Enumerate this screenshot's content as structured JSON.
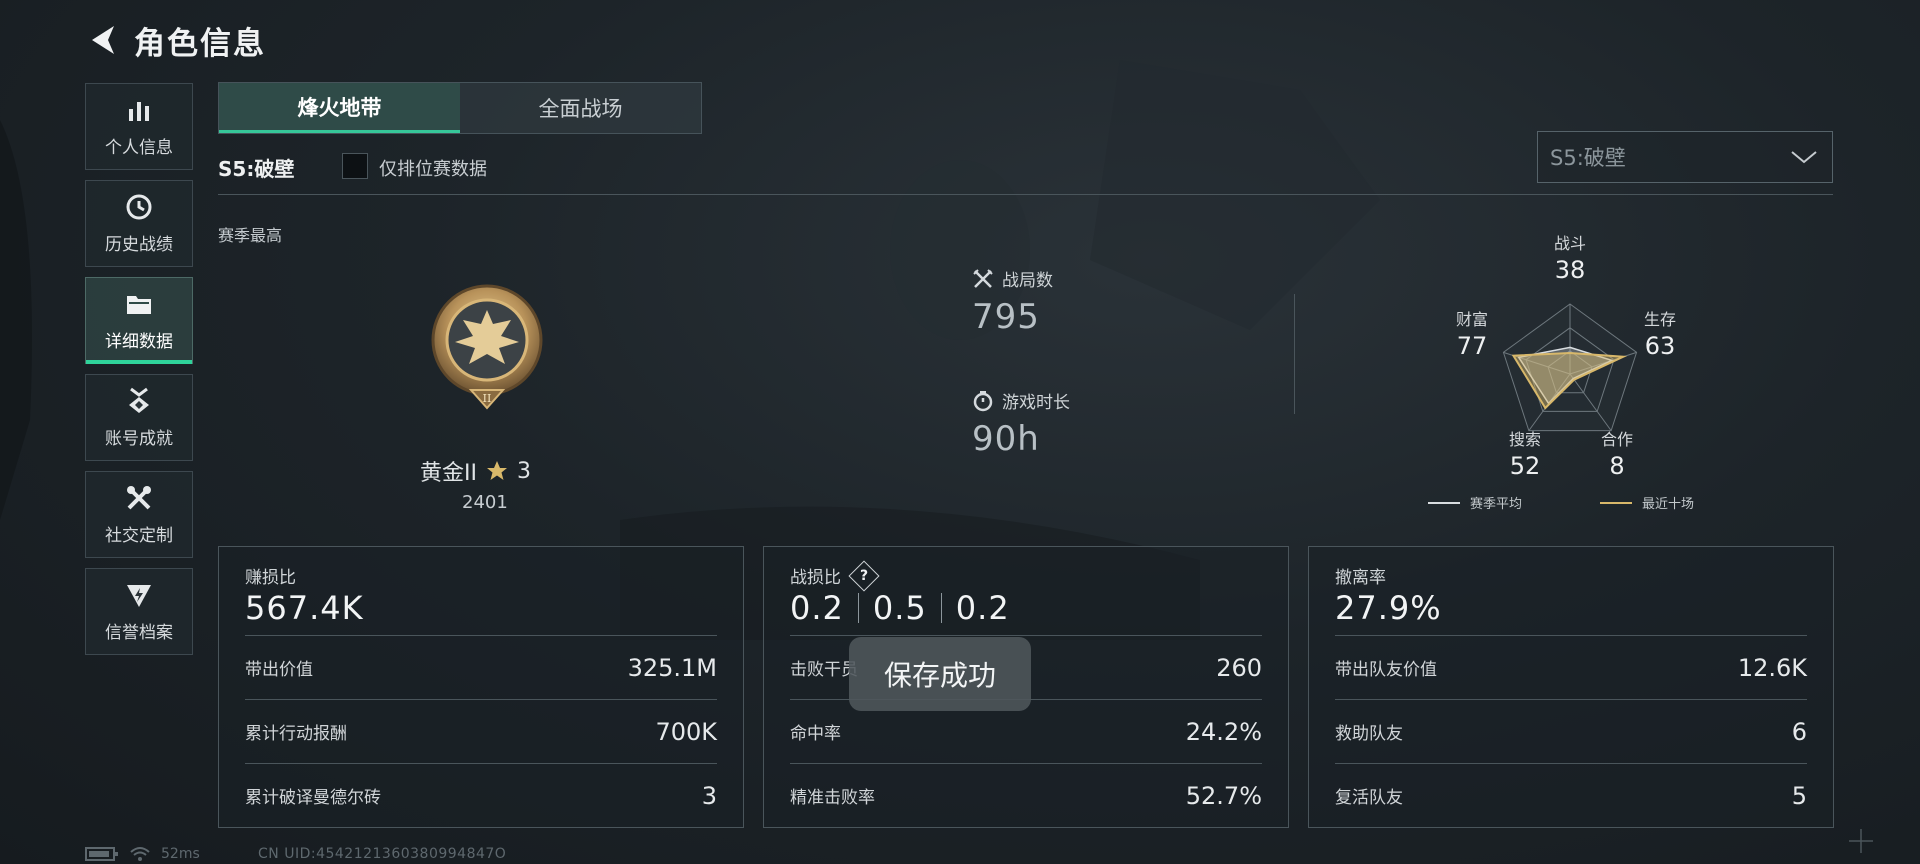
{
  "header": {
    "title": "角色信息"
  },
  "sidebar": {
    "items": [
      {
        "label": "个人信息",
        "icon": "bar-chart-icon"
      },
      {
        "label": "历史战绩",
        "icon": "clock-icon"
      },
      {
        "label": "详细数据",
        "icon": "folder-icon",
        "active": true
      },
      {
        "label": "账号成就",
        "icon": "medal-icon"
      },
      {
        "label": "社交定制",
        "icon": "tools-icon"
      },
      {
        "label": "信誉档案",
        "icon": "shield-bolt-icon"
      }
    ]
  },
  "tabs": [
    {
      "label": "烽火地带",
      "active": true
    },
    {
      "label": "全面战场",
      "active": false
    }
  ],
  "filter": {
    "season_label": "S5:破壁",
    "ranked_only_label": "仅排位赛数据",
    "season_dropdown": "S5:破壁"
  },
  "rank": {
    "section_label": "赛季最高",
    "name": "黄金II",
    "stars": "3",
    "score": "2401"
  },
  "overview": {
    "matches_label": "战局数",
    "matches_value": "795",
    "playtime_label": "游戏时长",
    "playtime_value": "90h"
  },
  "radar": {
    "labels": [
      "战斗",
      "生存",
      "合作",
      "搜索",
      "财富"
    ],
    "values": [
      "38",
      "63",
      "8",
      "52",
      "77"
    ],
    "season_avg": [
      38,
      63,
      8,
      52,
      77
    ],
    "recent_ten": [
      30,
      80,
      10,
      60,
      85
    ],
    "legend_season": "赛季平均",
    "legend_recent": "最近十场",
    "colors": {
      "season": "#d9dde0",
      "recent": "#d8b86a"
    }
  },
  "cards": [
    {
      "label": "赚损比",
      "main": "567.4K",
      "rows": [
        {
          "label": "带出价值",
          "value": "325.1M"
        },
        {
          "label": "累计行动报酬",
          "value": "700K"
        },
        {
          "label": "累计破译曼德尔砖",
          "value": "3"
        }
      ]
    },
    {
      "label": "战损比",
      "mains": [
        "0.2",
        "0.5",
        "0.2"
      ],
      "rows": [
        {
          "label": "击败干员",
          "value": "260"
        },
        {
          "label": "命中率",
          "value": "24.2%"
        },
        {
          "label": "精准击败率",
          "value": "52.7%"
        }
      ]
    },
    {
      "label": "撤离率",
      "main": "27.9%",
      "rows": [
        {
          "label": "带出队友价值",
          "value": "12.6K"
        },
        {
          "label": "救助队友",
          "value": "6"
        },
        {
          "label": "复活队友",
          "value": "5"
        }
      ]
    }
  ],
  "toast": "保存成功",
  "status": {
    "ping": "52ms",
    "uid": "CN UID:4542121360380994847O"
  }
}
